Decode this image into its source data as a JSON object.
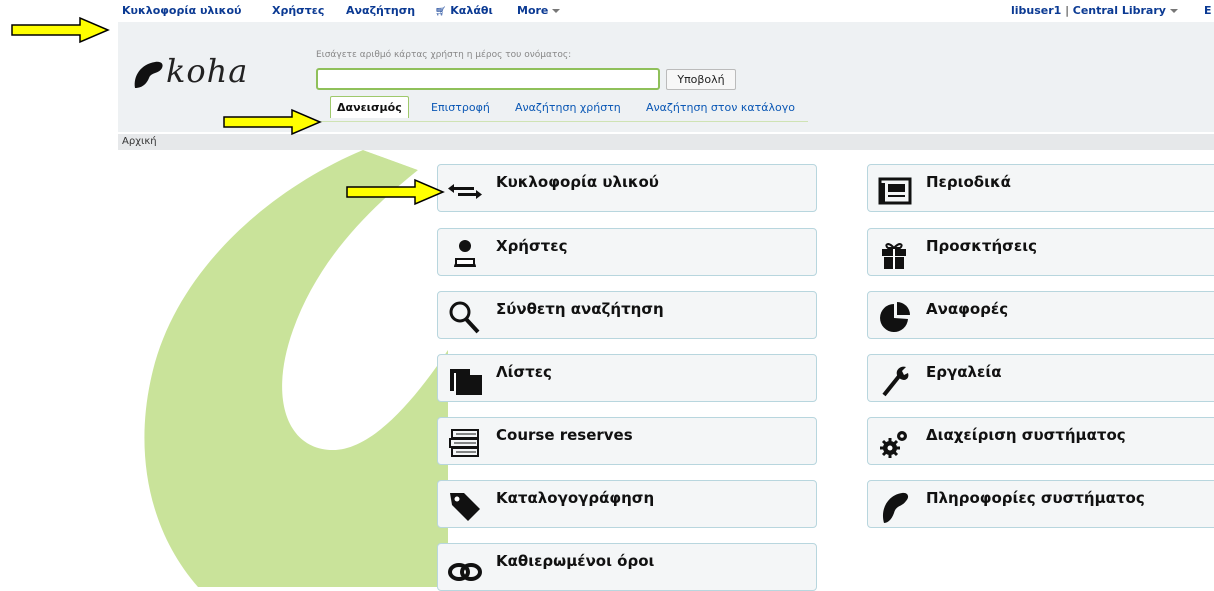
{
  "topnav": {
    "items": [
      "Κυκλοφορία υλικού",
      "Χρήστες",
      "Αναζήτηση",
      "Καλάθι",
      "More"
    ],
    "user": "libuser1",
    "separator": "|",
    "library": "Central Library",
    "truncated": "E"
  },
  "header": {
    "logo_text": "koha",
    "search_hint": "Εισάγετε αριθμό κάρτας χρήστη η μέρος του ονόματος:",
    "search_value": "",
    "submit_label": "Υποβολή",
    "tabs": [
      "Δανεισμός",
      "Επιστροφή",
      "Αναζήτηση χρήστη",
      "Αναζήτηση στον κατάλογο"
    ],
    "active_tab": "Δανεισμός"
  },
  "breadcrumb": "Αρχική",
  "modules": {
    "left": [
      {
        "label": "Κυκλοφορία υλικού",
        "icon": "circulation-icon"
      },
      {
        "label": "Χρήστες",
        "icon": "patrons-icon"
      },
      {
        "label": "Σύνθετη αναζήτηση",
        "icon": "search-icon"
      },
      {
        "label": "Λίστες",
        "icon": "folder-icon"
      },
      {
        "label": "Course reserves",
        "icon": "books-icon"
      },
      {
        "label": "Καταλογογράφηση",
        "icon": "tag-icon"
      },
      {
        "label": "Καθιερωμένοι όροι",
        "icon": "link-icon"
      }
    ],
    "right": [
      {
        "label": "Περιοδικά",
        "icon": "newspaper-icon"
      },
      {
        "label": "Προσκτήσεις",
        "icon": "gift-icon"
      },
      {
        "label": "Αναφορές",
        "icon": "pie-chart-icon"
      },
      {
        "label": "Εργαλεία",
        "icon": "wrench-icon"
      },
      {
        "label": "Διαχείριση συστήματος",
        "icon": "gears-icon"
      },
      {
        "label": "Πληροφορίες συστήματος",
        "icon": "koha-leaf-icon"
      }
    ]
  },
  "colors": {
    "nav_link": "#0b3a93",
    "swoosh": "#c9e39a",
    "tab_link": "#0b58b5",
    "arrow_fill": "#ffff00"
  }
}
